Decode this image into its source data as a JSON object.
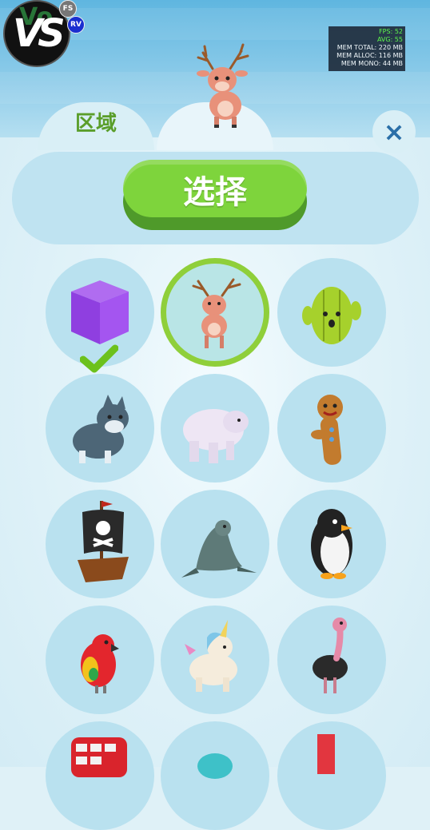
{
  "header": {
    "vs_logo_text": "VS",
    "vs_logo_bg_text": "Vo",
    "badge_fs": "FS",
    "badge_rv": "RV"
  },
  "perf": {
    "fps": "FPS: 52",
    "avg": "AVG: 55",
    "mem_total": "MEM TOTAL: 220 MB",
    "mem_alloc": "MEM ALLOC: 116 MB",
    "mem_mono": "MEM MONO: 44 MB"
  },
  "tabs": [
    {
      "label": "区域",
      "active": false
    },
    {
      "label": "",
      "active": true,
      "icon": "deer"
    }
  ],
  "close_icon": "×",
  "select_button_label": "选择",
  "colors": {
    "accent_green": "#7ed43c",
    "tab_text": "#5a9e2a",
    "close_blue": "#2a6fa8",
    "cell_bg": "#b9e1ef"
  },
  "grid": [
    {
      "icon": "purple-cube",
      "equipped": true
    },
    {
      "icon": "deer",
      "selected": true
    },
    {
      "icon": "cactus"
    },
    {
      "icon": "wolf"
    },
    {
      "icon": "polar-bear"
    },
    {
      "icon": "gingerbread-man"
    },
    {
      "icon": "pirate-ship"
    },
    {
      "icon": "seal"
    },
    {
      "icon": "penguin"
    },
    {
      "icon": "parrot"
    },
    {
      "icon": "unicorn"
    },
    {
      "icon": "ostrich"
    },
    {
      "icon": "red-bus"
    },
    {
      "icon": "teal-ball"
    },
    {
      "icon": "red-block"
    }
  ]
}
